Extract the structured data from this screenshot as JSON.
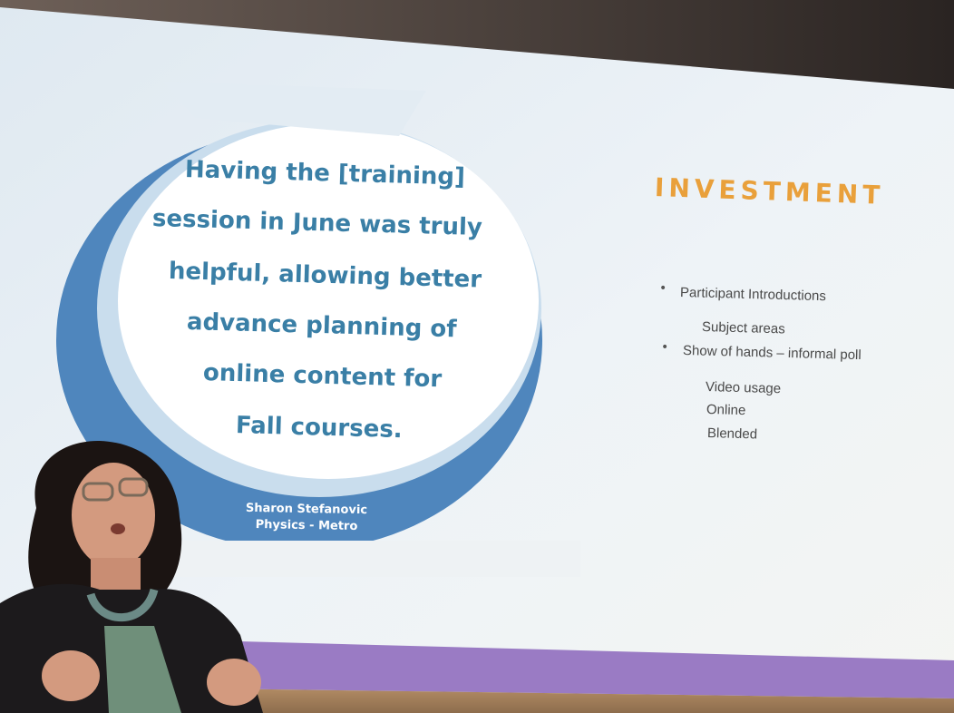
{
  "slide": {
    "quote_lines": [
      "Having the [training]",
      "session in June was truly",
      "helpful, allowing better",
      "advance planning of",
      "online content for",
      "Fall courses."
    ],
    "author_name": "Sharon Stefanovic",
    "author_dept": "Physics - Metro",
    "title": "INVESTMENT",
    "items": [
      {
        "text": "Participant Introductions",
        "bullet": "•"
      },
      {
        "text": "Subject areas",
        "bullet": ""
      },
      {
        "text": "Show of hands – informal poll",
        "bullet": "•"
      },
      {
        "text": "Video usage",
        "bullet": ""
      },
      {
        "text": "Online",
        "bullet": ""
      },
      {
        "text": "Blended",
        "bullet": ""
      }
    ]
  },
  "colors": {
    "screen": "#e6eef4",
    "circle_blue": "#4f86bd",
    "light_ring": "#c9dded",
    "title_orange": "#e9a03b",
    "purple_band": "#9a7bc4"
  }
}
